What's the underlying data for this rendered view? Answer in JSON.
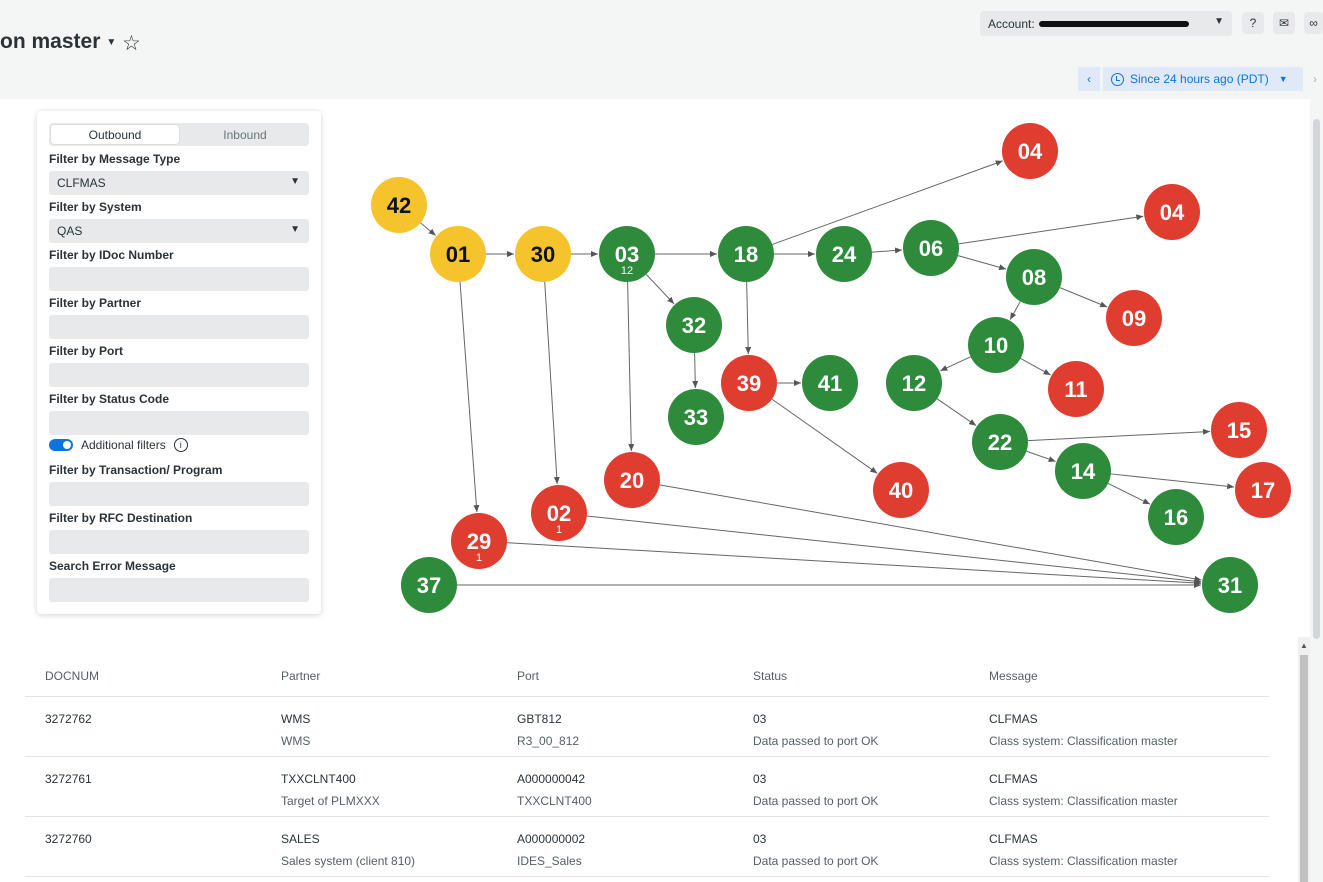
{
  "header": {
    "title": "on master",
    "account_label": "Account:",
    "time_range": "Since 24 hours ago (PDT)"
  },
  "filters": {
    "tabs": [
      "Outbound",
      "Inbound"
    ],
    "active_tab": "Outbound",
    "message_type_label": "Filter by Message Type",
    "message_type_value": "CLFMAS",
    "system_label": "Filter by System",
    "system_value": "QAS",
    "idoc_label": "Filter by IDoc Number",
    "partner_label": "Filter by Partner",
    "port_label": "Filter by Port",
    "status_label": "Filter by Status Code",
    "additional_label": "Additional filters",
    "transaction_label": "Filter by Transaction/ Program",
    "rfc_label": "Filter by RFC Destination",
    "error_label": "Search Error Message"
  },
  "colors": {
    "yellow": "#f5c32c",
    "green": "#2e8b3c",
    "red": "#df3d2f",
    "accent": "#0c74df"
  },
  "graph": {
    "nodes": [
      {
        "id": "n42",
        "label": "42",
        "color": "yellow"
      },
      {
        "id": "n01",
        "label": "01",
        "color": "yellow"
      },
      {
        "id": "n30",
        "label": "30",
        "color": "yellow"
      },
      {
        "id": "n03",
        "label": "03",
        "sub": "12",
        "color": "green"
      },
      {
        "id": "n18",
        "label": "18",
        "color": "green"
      },
      {
        "id": "n24",
        "label": "24",
        "color": "green"
      },
      {
        "id": "n06",
        "label": "06",
        "color": "green"
      },
      {
        "id": "n04a",
        "label": "04",
        "color": "red"
      },
      {
        "id": "n04b",
        "label": "04",
        "color": "red"
      },
      {
        "id": "n08",
        "label": "08",
        "color": "green"
      },
      {
        "id": "n09",
        "label": "09",
        "color": "red"
      },
      {
        "id": "n32",
        "label": "32",
        "color": "green"
      },
      {
        "id": "n33",
        "label": "33",
        "color": "green"
      },
      {
        "id": "n39",
        "label": "39",
        "color": "red"
      },
      {
        "id": "n41",
        "label": "41",
        "color": "green"
      },
      {
        "id": "n10",
        "label": "10",
        "color": "green"
      },
      {
        "id": "n11",
        "label": "11",
        "color": "red"
      },
      {
        "id": "n12",
        "label": "12",
        "color": "green"
      },
      {
        "id": "n22",
        "label": "22",
        "color": "green"
      },
      {
        "id": "n15",
        "label": "15",
        "color": "red"
      },
      {
        "id": "n14",
        "label": "14",
        "color": "green"
      },
      {
        "id": "n17",
        "label": "17",
        "color": "red"
      },
      {
        "id": "n16",
        "label": "16",
        "color": "green"
      },
      {
        "id": "n40",
        "label": "40",
        "color": "red"
      },
      {
        "id": "n20",
        "label": "20",
        "color": "red"
      },
      {
        "id": "n02",
        "label": "02",
        "sub": "1",
        "color": "red"
      },
      {
        "id": "n29",
        "label": "29",
        "sub": "1",
        "color": "red"
      },
      {
        "id": "n37",
        "label": "37",
        "color": "green"
      },
      {
        "id": "n31",
        "label": "31",
        "color": "green"
      }
    ],
    "edges": [
      [
        "n42",
        "n01"
      ],
      [
        "n01",
        "n30"
      ],
      [
        "n30",
        "n03"
      ],
      [
        "n03",
        "n18"
      ],
      [
        "n18",
        "n24"
      ],
      [
        "n24",
        "n06"
      ],
      [
        "n18",
        "n04a"
      ],
      [
        "n06",
        "n04b"
      ],
      [
        "n06",
        "n08"
      ],
      [
        "n08",
        "n09"
      ],
      [
        "n08",
        "n10"
      ],
      [
        "n10",
        "n11"
      ],
      [
        "n10",
        "n12"
      ],
      [
        "n12",
        "n22"
      ],
      [
        "n22",
        "n15"
      ],
      [
        "n22",
        "n14"
      ],
      [
        "n14",
        "n17"
      ],
      [
        "n14",
        "n16"
      ],
      [
        "n03",
        "n32"
      ],
      [
        "n32",
        "n33"
      ],
      [
        "n18",
        "n39"
      ],
      [
        "n39",
        "n41"
      ],
      [
        "n39",
        "n40"
      ],
      [
        "n03",
        "n20"
      ],
      [
        "n01",
        "n29"
      ],
      [
        "n30",
        "n02"
      ],
      [
        "n20",
        "n31"
      ],
      [
        "n02",
        "n31"
      ],
      [
        "n29",
        "n31"
      ],
      [
        "n37",
        "n31"
      ]
    ]
  },
  "table": {
    "headers": [
      "DOCNUM",
      "Partner",
      "Port",
      "Status",
      "Message"
    ],
    "rows": [
      {
        "docnum": "3272762",
        "partner": "WMS",
        "partner2": "WMS",
        "port": "GBT812",
        "port2": "R3_00_812",
        "status": "03",
        "status2": "Data passed to port OK",
        "message": "CLFMAS",
        "message2": "Class system: Classification master"
      },
      {
        "docnum": "3272761",
        "partner": "TXXCLNT400",
        "partner2": "Target of PLMXXX",
        "port": "A000000042",
        "port2": "TXXCLNT400",
        "status": "03",
        "status2": "Data passed to port OK",
        "message": "CLFMAS",
        "message2": "Class system: Classification master"
      },
      {
        "docnum": "3272760",
        "partner": "SALES",
        "partner2": "Sales system (client 810)",
        "port": "A000000002",
        "port2": "IDES_Sales",
        "status": "03",
        "status2": "Data passed to port OK",
        "message": "CLFMAS",
        "message2": "Class system: Classification master"
      }
    ]
  }
}
